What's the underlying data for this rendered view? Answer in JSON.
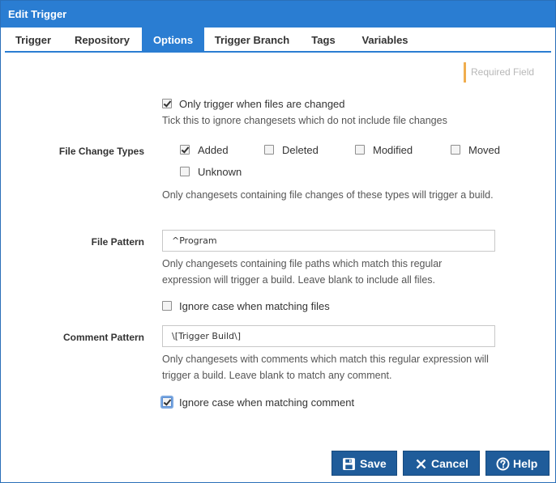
{
  "dialog": {
    "title": "Edit Trigger"
  },
  "tabs": [
    {
      "label": "Trigger"
    },
    {
      "label": "Repository"
    },
    {
      "label": "Options",
      "active": true
    },
    {
      "label": "Trigger Branch"
    },
    {
      "label": "Tags"
    },
    {
      "label": "Variables"
    }
  ],
  "required_field": "Required Field",
  "only_trigger": {
    "label": "Only trigger when files are changed",
    "checked": true,
    "help": "Tick this to ignore changesets which do not include file changes"
  },
  "file_change_types": {
    "label": "File Change Types",
    "options": [
      {
        "label": "Added",
        "checked": true
      },
      {
        "label": "Deleted",
        "checked": false
      },
      {
        "label": "Modified",
        "checked": false
      },
      {
        "label": "Moved",
        "checked": false
      },
      {
        "label": "Unknown",
        "checked": false
      }
    ],
    "help": "Only changesets containing file changes of these types will trigger a build."
  },
  "file_pattern": {
    "label": "File Pattern",
    "value": "^Program",
    "help": "Only changesets containing file paths which match this regular expression will trigger a build. Leave blank to include all files."
  },
  "ignore_case_files": {
    "label": "Ignore case when matching files",
    "checked": false
  },
  "comment_pattern": {
    "label": "Comment Pattern",
    "value": "\\[Trigger Build\\]",
    "help": "Only changesets with comments which match this regular expression will trigger a build. Leave blank to match any comment."
  },
  "ignore_case_comment": {
    "label": "Ignore case when matching comment",
    "checked": true
  },
  "buttons": {
    "save": "Save",
    "cancel": "Cancel",
    "help": "Help"
  },
  "colors": {
    "primary": "#2a7dd2",
    "button": "#1f5c9a",
    "required_marker": "#f0ad4e"
  }
}
